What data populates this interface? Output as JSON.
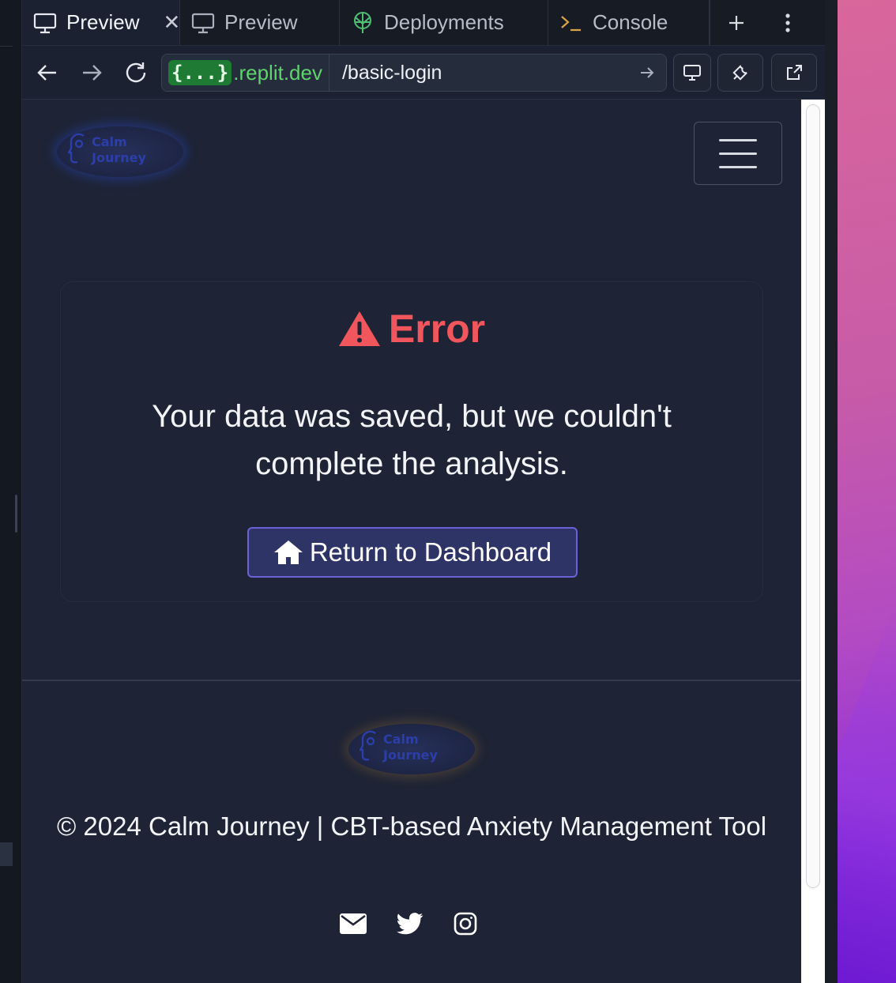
{
  "tabs": [
    {
      "label": "Preview",
      "icon": "monitor-icon",
      "active": true,
      "closable": true
    },
    {
      "label": "Preview",
      "icon": "monitor-icon",
      "active": false
    },
    {
      "label": "Deployments",
      "icon": "deploy-icon",
      "active": false
    },
    {
      "label": "Console",
      "icon": "terminal-icon",
      "active": false
    }
  ],
  "address_bar": {
    "badge": "{...}",
    "host": ".replit.dev",
    "path": "/basic-login"
  },
  "page": {
    "logo_text_line1": "Calm",
    "logo_text_line2": "Journey",
    "error_title": "Error",
    "error_message": "Your data was saved, but we couldn't complete the analysis.",
    "dashboard_button": "Return to Dashboard",
    "copyright": "© 2024 Calm Journey | CBT-based Anxiety Management Tool",
    "social_icons": [
      "envelope-icon",
      "twitter-icon",
      "instagram-icon"
    ]
  },
  "colors": {
    "error": "#f1565c",
    "button_bg": "#2e3466",
    "button_border": "#6b62d8",
    "url_host": "#5fd36e",
    "url_badge_bg": "#1f7a34"
  }
}
